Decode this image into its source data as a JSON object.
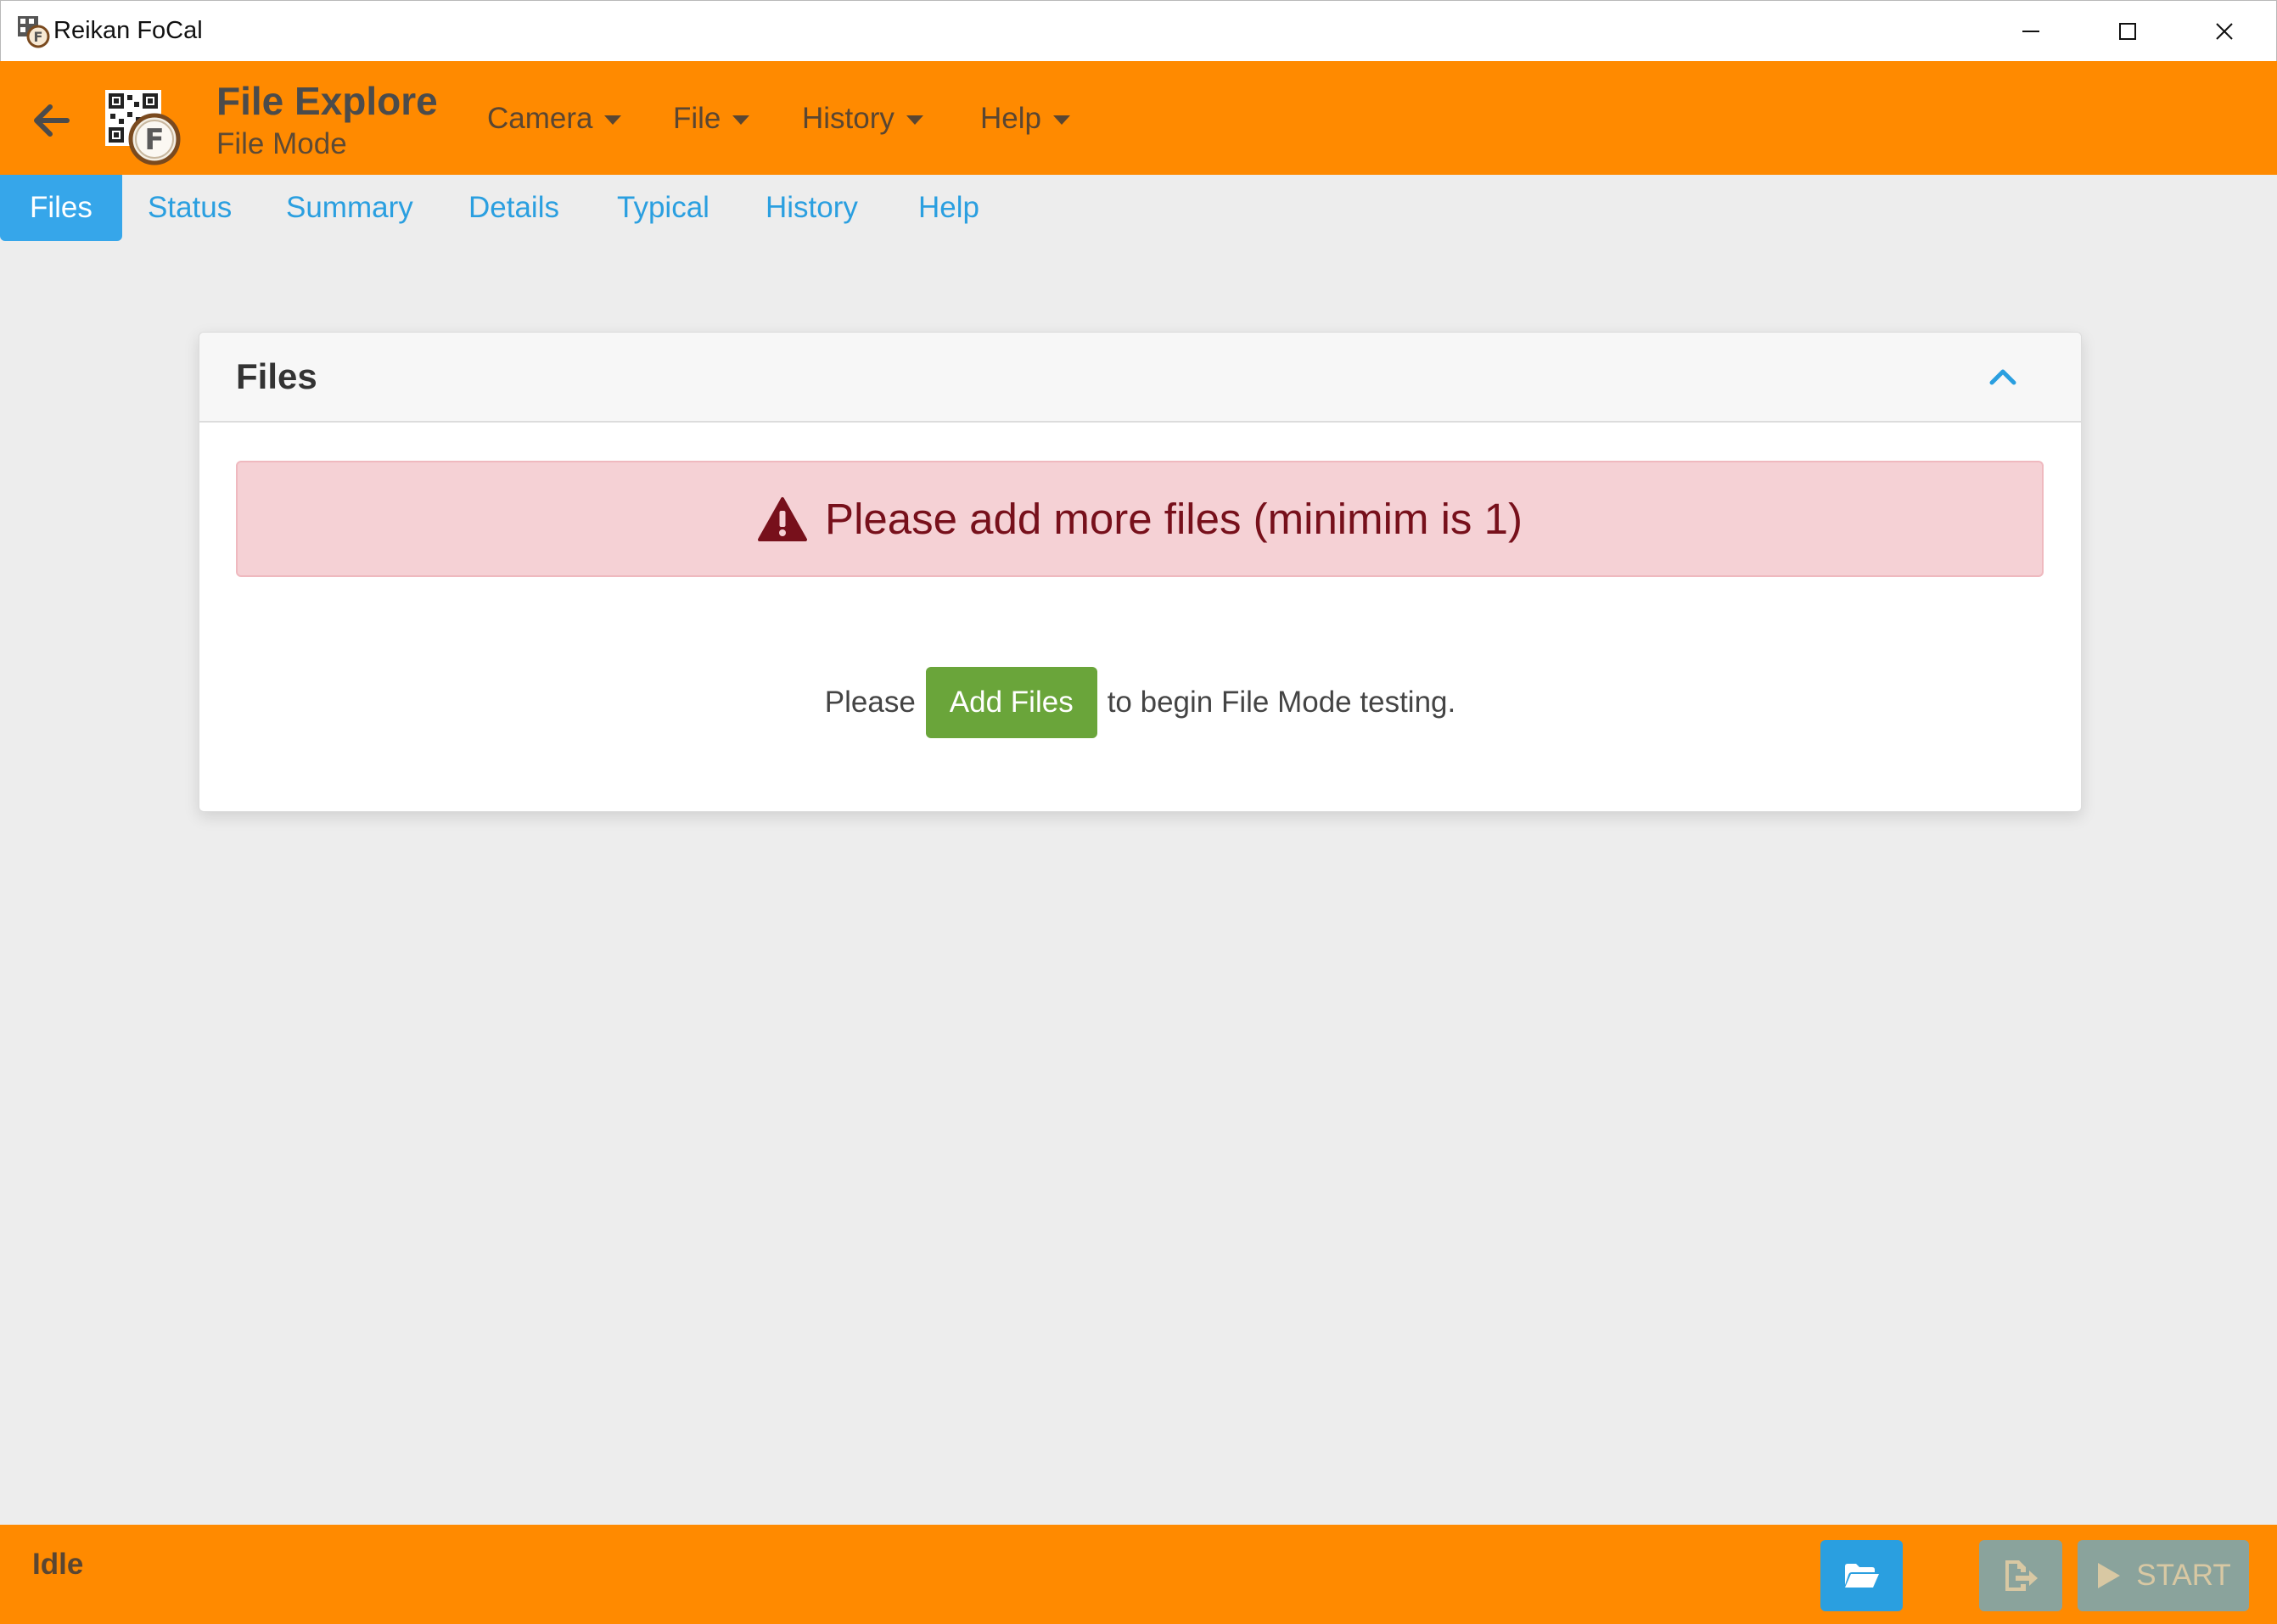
{
  "window": {
    "title": "Reikan FoCal"
  },
  "header": {
    "title": "File Explore",
    "subtitle": "File Mode",
    "menus": [
      "Camera",
      "File",
      "History",
      "Help"
    ]
  },
  "tabs": [
    "Files",
    "Status",
    "Summary",
    "Details",
    "Typical",
    "History",
    "Help"
  ],
  "active_tab": "Files",
  "card": {
    "title": "Files",
    "alert_text": "Please add more files (minimim is 1)",
    "prompt_before": "Please",
    "add_button": "Add Files",
    "prompt_after": "to begin File Mode testing."
  },
  "footer": {
    "status": "Idle",
    "start_label": "START"
  },
  "colors": {
    "accent_orange": "#ff8a00",
    "tab_blue": "#36a6ea",
    "alert_bg": "#f5d1d5",
    "alert_text": "#77101b",
    "add_green": "#6aa53a",
    "disabled_btn": "#8aa39c"
  },
  "icons": [
    "app-icon",
    "minimize-icon",
    "maximize-icon",
    "close-icon",
    "back-arrow-icon",
    "focal-logo-icon",
    "chevron-up-icon",
    "warning-triangle-icon",
    "folder-open-icon",
    "export-icon",
    "play-icon"
  ]
}
